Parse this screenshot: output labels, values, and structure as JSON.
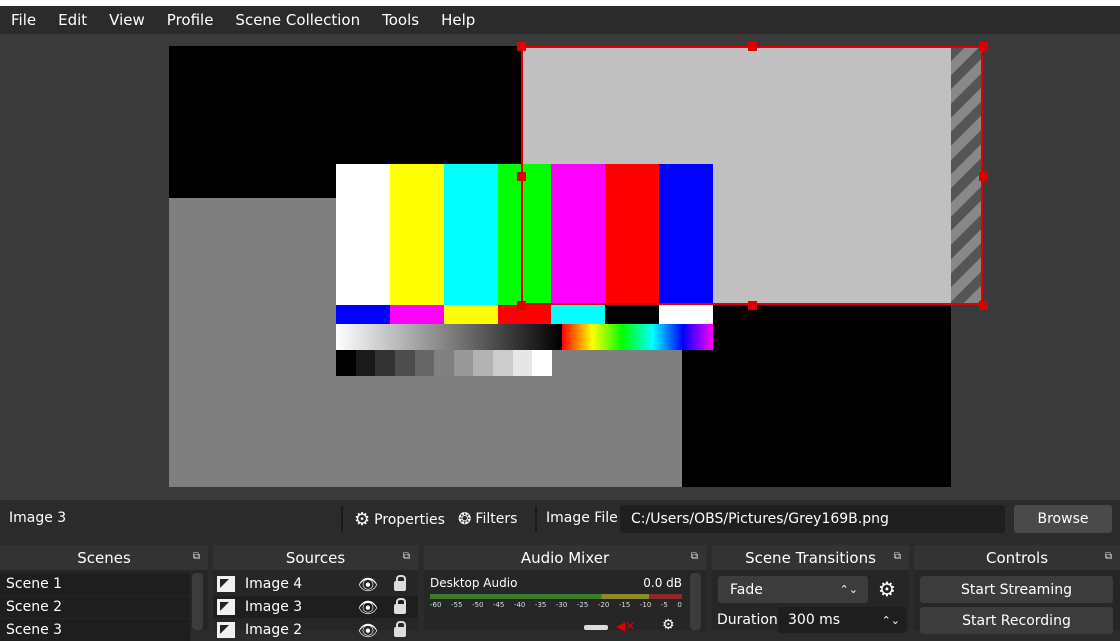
{
  "menu": [
    "File",
    "Edit",
    "View",
    "Profile",
    "Scene Collection",
    "Tools",
    "Help"
  ],
  "preview": {
    "color_bars": [
      "#ffffff",
      "#ffff00",
      "#00ffff",
      "#00ff00",
      "#ff00ff",
      "#ff0000",
      "#0000ff"
    ],
    "bottom_strip": [
      "#0000ff",
      "#ff00ff",
      "#ffff00",
      "#ff0000",
      "#00ffff",
      "#000000",
      "#ffffff"
    ],
    "steps": [
      "#000000",
      "#1a1a1a",
      "#333333",
      "#4d4d4d",
      "#666666",
      "#808080",
      "#999999",
      "#b3b3b3",
      "#cccccc",
      "#e6e6e6",
      "#ffffff"
    ],
    "selection_color": "#e00000"
  },
  "properties_bar": {
    "selected_source": "Image 3",
    "properties_label": "Properties",
    "filters_label": "Filters",
    "image_file_label": "Image File",
    "path": "C:/Users/OBS/Pictures/Grey169B.png",
    "browse_label": "Browse"
  },
  "docks": {
    "scenes": {
      "title": "Scenes",
      "items": [
        "Scene 1",
        "Scene 2",
        "Scene 3"
      ]
    },
    "sources": {
      "title": "Sources",
      "items": [
        "Image 4",
        "Image 3",
        "Image 2"
      ]
    },
    "audio_mixer": {
      "title": "Audio Mixer",
      "channel": "Desktop Audio",
      "level": "0.0 dB",
      "scale": [
        "-60",
        "-55",
        "-50",
        "-45",
        "-40",
        "-35",
        "-30",
        "-25",
        "-20",
        "-15",
        "-10",
        "-5",
        "0"
      ]
    },
    "transitions": {
      "title": "Scene Transitions",
      "transition": "Fade",
      "duration_label": "Duration",
      "duration_value": "300 ms"
    },
    "controls": {
      "title": "Controls",
      "start_streaming": "Start Streaming",
      "start_recording": "Start Recording"
    }
  }
}
